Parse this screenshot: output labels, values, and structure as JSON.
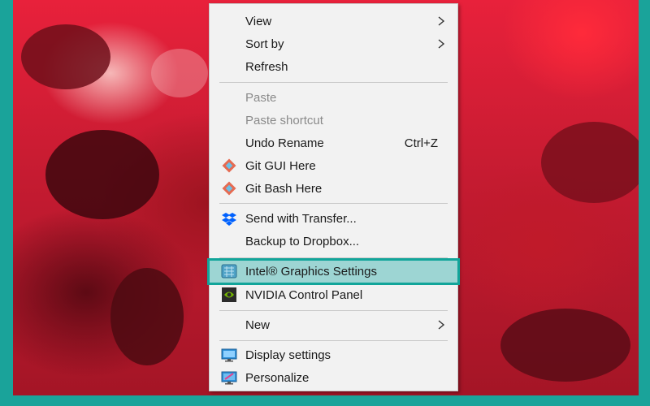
{
  "context_menu": {
    "view": "View",
    "sort_by": "Sort by",
    "refresh": "Refresh",
    "paste": "Paste",
    "paste_shortcut": "Paste shortcut",
    "undo_rename": "Undo Rename",
    "undo_shortcut": "Ctrl+Z",
    "git_gui": "Git GUI Here",
    "git_bash": "Git Bash Here",
    "send_transfer": "Send with Transfer...",
    "backup_dropbox": "Backup to Dropbox...",
    "intel_graphics": "Intel® Graphics Settings",
    "nvidia": "NVIDIA Control Panel",
    "new": "New",
    "display_settings": "Display settings",
    "personalize": "Personalize"
  },
  "colors": {
    "menu_bg": "#f2f2f2",
    "highlight_fill": "#9dd5d3",
    "highlight_border": "#12a59a",
    "frame": "#1aa39a"
  },
  "icons": [
    "git-icon",
    "dropbox-icon",
    "intel-graphics-icon",
    "nvidia-icon",
    "display-icon",
    "personalize-icon",
    "chevron-right-icon"
  ]
}
